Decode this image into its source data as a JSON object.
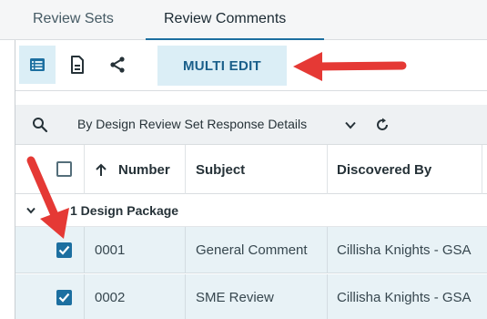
{
  "tabs": [
    {
      "label": "Review Sets"
    },
    {
      "label": "Review Comments"
    }
  ],
  "toolbar": {
    "list_view_icon": "list-view-icon",
    "document_icon": "document-icon",
    "share_icon": "share-icon",
    "multi_edit_label": "MULTI EDIT"
  },
  "grouping": {
    "search_icon": "search-icon",
    "label": "By Design Review Set Response Details",
    "chevron_icon": "chevron-down-icon",
    "refresh_icon": "refresh-icon"
  },
  "table": {
    "columns": [
      "Number",
      "Subject",
      "Discovered By"
    ],
    "sort_icon": "arrow-up-icon",
    "group": {
      "label": "1 Design Package"
    },
    "rows": [
      {
        "number": "0001",
        "subject": "General Comment",
        "discovered_by": "Cillisha Knights - GSA",
        "checked": true
      },
      {
        "number": "0002",
        "subject": "SME Review",
        "discovered_by": "Cillisha Knights - GSA",
        "checked": true
      }
    ]
  },
  "colors": {
    "accent": "#1c6fa0",
    "selected_row": "#e8f2f6",
    "annotation_arrow": "#e53935"
  }
}
